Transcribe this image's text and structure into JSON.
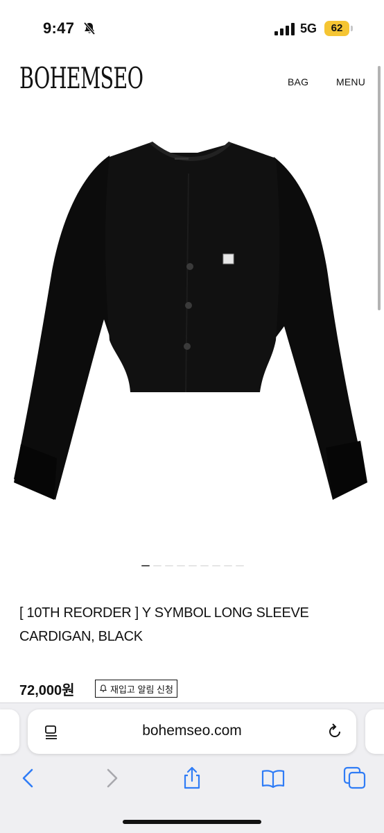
{
  "status_bar": {
    "time": "9:47",
    "network": "5G",
    "battery": "62",
    "colors": {
      "battery_fill": "#f5c533"
    }
  },
  "header": {
    "logo": "BOHEMSEO",
    "bag_label": "BAG",
    "menu_label": "MENU"
  },
  "product": {
    "image_icon": "black-cardigan-photo",
    "carousel": {
      "count": 9,
      "active": 1
    },
    "title": "[ 10TH REORDER ] Y SYMBOL LONG SLEEVE CARDIGAN, BLACK",
    "price": "72,000원",
    "restock_label": "재입고 알림 신청"
  },
  "browser": {
    "url": "bohemseo.com",
    "toolbar_icons": [
      "back-icon",
      "forward-icon",
      "share-icon",
      "bookmarks-icon",
      "tabs-icon"
    ]
  }
}
